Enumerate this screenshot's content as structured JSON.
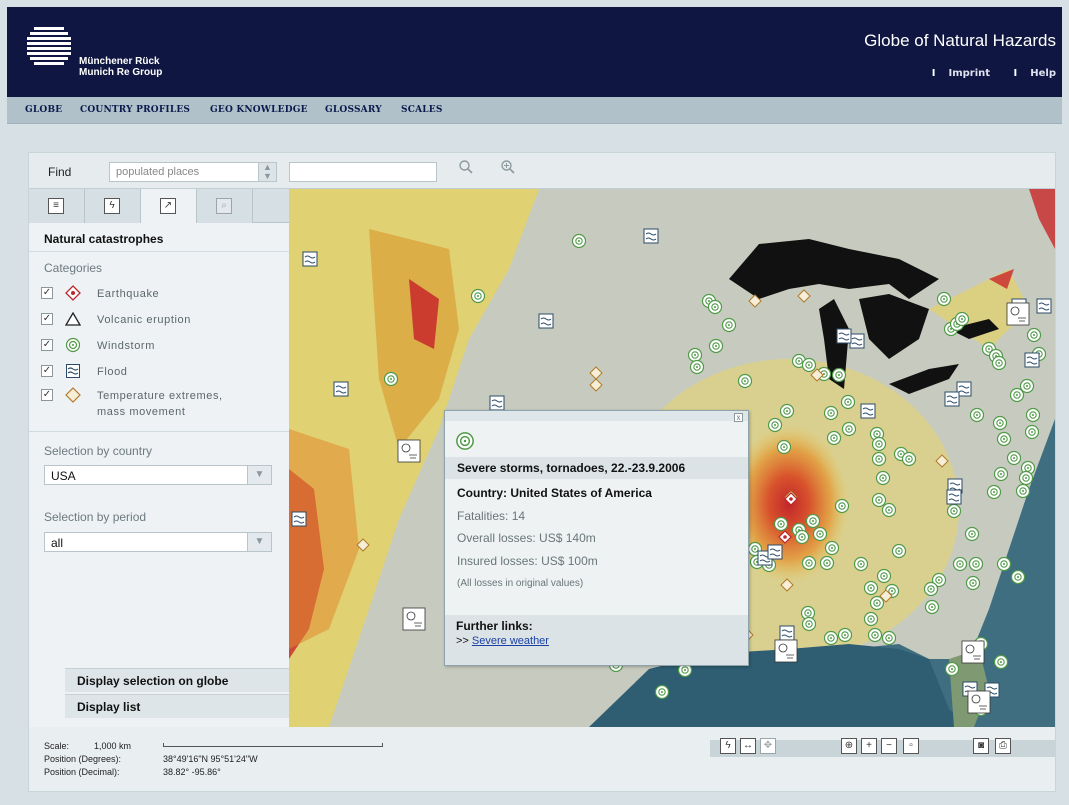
{
  "header": {
    "company_line1": "Münchener Rück",
    "company_line2": "Munich Re Group",
    "app_title": "Globe of Natural Hazards",
    "links": [
      "Imprint",
      "Help"
    ]
  },
  "nav": {
    "items": [
      "GLOBE",
      "COUNTRY PROFILES",
      "GEO KNOWLEDGE",
      "GLOSSARY",
      "SCALES"
    ]
  },
  "find": {
    "label": "Find",
    "select_value": "populated places",
    "input_value": "",
    "search_icon": "magnifier-icon",
    "zoom_search_icon": "zoom-magnifier-icon"
  },
  "panel": {
    "tabs": [
      {
        "name": "list-tab",
        "icon": "list-icon"
      },
      {
        "name": "hazards-tab",
        "icon": "lightning-icon"
      },
      {
        "name": "catastrophes-tab",
        "icon": "zigzag-icon"
      },
      {
        "name": "search-tab",
        "icon": "search-icon"
      }
    ],
    "title": "Natural catastrophes",
    "categories_label": "Categories",
    "categories": [
      {
        "label": "Earthquake",
        "checked": true,
        "icon": "earthquake-icon"
      },
      {
        "label": "Volcanic eruption",
        "checked": true,
        "icon": "volcano-icon"
      },
      {
        "label": "Windstorm",
        "checked": true,
        "icon": "windstorm-icon"
      },
      {
        "label": "Flood",
        "checked": true,
        "icon": "flood-icon"
      },
      {
        "label": "Temperature extremes,",
        "label2": "mass movement",
        "checked": true,
        "icon": "temperature-icon"
      }
    ],
    "country_label": "Selection by country",
    "country_value": "USA",
    "period_label": "Selection by period",
    "period_value": "all",
    "display_globe": "Display selection on globe",
    "display_list": "Display list"
  },
  "popup": {
    "title": "Severe storms, tornadoes, 22.-23.9.2006",
    "country_label": "Country:",
    "country_value": "United States of America",
    "fatalities_label": "Fatalities:",
    "fatalities_value": "14",
    "overall_label": "Overall losses:",
    "overall_value": "US$ 140m",
    "insured_label": "Insured losses:",
    "insured_value": "US$ 100m",
    "note": "(All losses in original values)",
    "links_title": "Further links:",
    "link_prefix": ">>",
    "link_text": "Severe weather",
    "close": "x"
  },
  "status": {
    "scale_label": "Scale:",
    "scale_value": "1,000 km",
    "pos_deg_label": "Position (Degrees):",
    "pos_deg_value": "38°49'16\"N 95°51'24\"W",
    "pos_dec_label": "Position (Decimal):",
    "pos_dec_value": "38.82° -95.86°"
  },
  "colors": {
    "header_bg": "#0f1641",
    "nav_bg": "#b0c1c9",
    "water": "#3b6b7e",
    "land": "#c8ccc0",
    "hazard_high": "#c8272a",
    "hazard_mid": "#e08a2e",
    "hazard_low": "#e8d35a"
  }
}
